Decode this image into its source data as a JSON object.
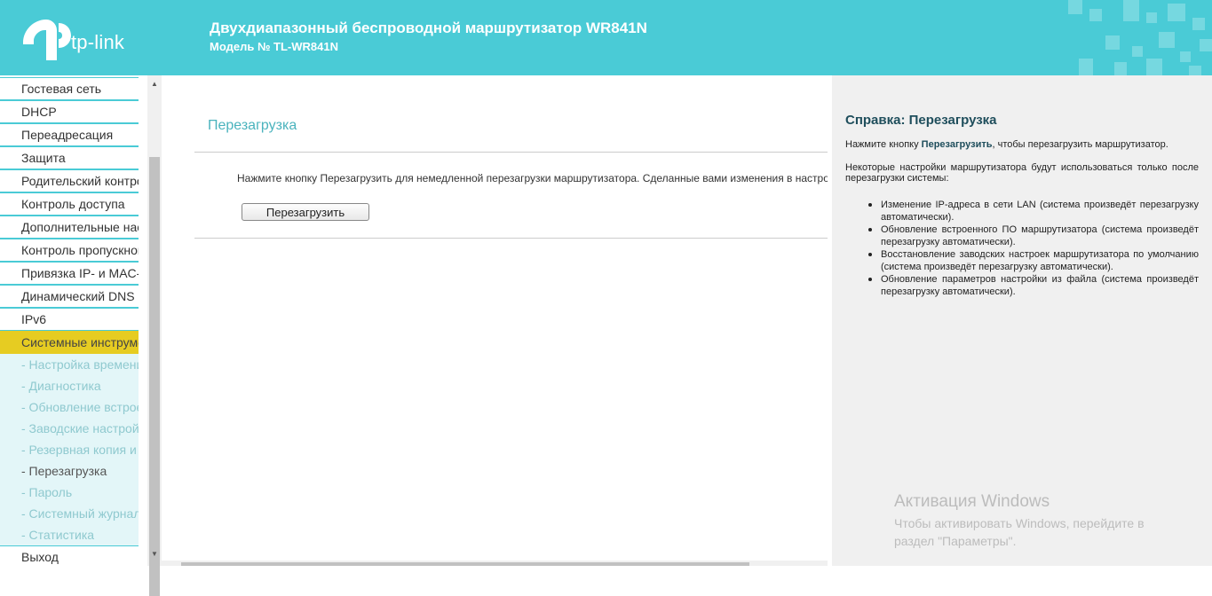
{
  "header": {
    "logo_text": "tp-link",
    "title": "Двухдиапазонный беспроводной маршрутизатор WR841N",
    "model": "Модель № TL-WR841N"
  },
  "sidebar": {
    "items": [
      {
        "label": "Гостевая сеть"
      },
      {
        "label": "DHCP"
      },
      {
        "label": "Переадресация"
      },
      {
        "label": "Защита"
      },
      {
        "label": "Родительский контроль"
      },
      {
        "label": "Контроль доступа"
      },
      {
        "label": "Дополнительные настройки маршрутизации"
      },
      {
        "label": "Контроль пропускной способности"
      },
      {
        "label": "Привязка IP- и MAC-адресов"
      },
      {
        "label": "Динамический DNS"
      },
      {
        "label": "IPv6"
      },
      {
        "label": "Системные инструменты"
      }
    ],
    "subitems": [
      {
        "label": "- Настройка времени"
      },
      {
        "label": "- Диагностика"
      },
      {
        "label": "- Обновление встроенного ПО"
      },
      {
        "label": "- Заводские настройки"
      },
      {
        "label": "- Резервная копия и восстановление"
      },
      {
        "label": "- Перезагрузка"
      },
      {
        "label": "- Пароль"
      },
      {
        "label": "- Системный журнал"
      },
      {
        "label": "- Статистика"
      }
    ],
    "logout": "Выход"
  },
  "main": {
    "section_title": "Перезагрузка",
    "description": "Нажмите кнопку Перезагрузить для немедленной перезагрузки маршрутизатора. Сделанные вами изменения в настройках вступят в силу после перезагрузки.",
    "reboot_button": "Перезагрузить"
  },
  "help": {
    "title": "Справка: Перезагрузка",
    "p1_prefix": "Нажмите кнопку ",
    "p1_bold": "Перезагрузить",
    "p1_suffix": ", чтобы перезагрузить маршрутизатор.",
    "p2": "Некоторые настройки маршрутизатора будут использоваться только после перезагрузки системы:",
    "list": [
      "Изменение IP-адреса в сети LAN (система произведёт перезагрузку автоматически).",
      "Обновление встроенного ПО маршрутизатора (система произведёт перезагрузку автоматически).",
      "Восстановление заводских настроек маршрутизатора по умолчанию (система произведёт перезагрузку автоматически).",
      "Обновление параметров настройки из файла (система произведёт перезагрузку автоматически)."
    ]
  },
  "watermark": {
    "title": "Активация Windows",
    "text": "Чтобы активировать Windows, перейдите в раздел \"Параметры\"."
  },
  "colors": {
    "header_bg": "#4acbd6",
    "active_item": "#e6cc22",
    "accent_text": "#4ab3bd"
  }
}
